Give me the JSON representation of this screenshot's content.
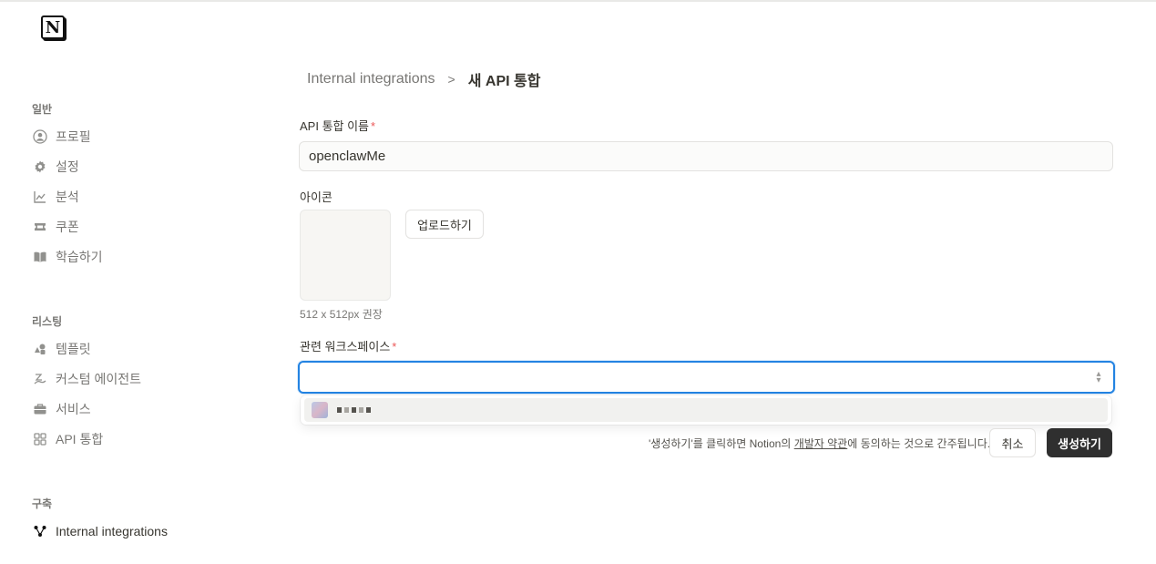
{
  "sidebar": {
    "sections": [
      {
        "label": "일반",
        "items": [
          {
            "label": "프로필",
            "icon": "profile-icon"
          },
          {
            "label": "설정",
            "icon": "gear-icon"
          },
          {
            "label": "분석",
            "icon": "chart-icon"
          },
          {
            "label": "쿠폰",
            "icon": "ticket-icon"
          },
          {
            "label": "학습하기",
            "icon": "book-icon"
          }
        ]
      },
      {
        "label": "리스팅",
        "items": [
          {
            "label": "템플릿",
            "icon": "shapes-icon"
          },
          {
            "label": "커스텀 에이전트",
            "icon": "agent-icon"
          },
          {
            "label": "서비스",
            "icon": "briefcase-icon"
          },
          {
            "label": "API 통합",
            "icon": "grid-icon"
          }
        ]
      },
      {
        "label": "구축",
        "items": [
          {
            "label": "Internal integrations",
            "icon": "nodes-icon"
          }
        ]
      }
    ]
  },
  "breadcrumb": {
    "parent": "Internal integrations",
    "separator": ">",
    "current": "새 API 통합"
  },
  "form": {
    "name_label": "API 통합 이름",
    "required_mark": "*",
    "name_value": "openclawMe",
    "icon_label": "아이콘",
    "upload_label": "업로드하기",
    "icon_hint": "512 x 512px 권장",
    "workspace_label": "관련 워크스페이스",
    "workspace_value": ""
  },
  "footer": {
    "note_prefix": "'생성하기'를 클릭하면 Notion의 ",
    "note_link": "개발자 약관",
    "note_suffix": "에 동의하는 것으로 간주됩니다.",
    "cancel_label": "취소",
    "create_label": "생성하기"
  },
  "colors": {
    "accent": "#2383e2",
    "required": "#eb5757",
    "primary_button": "#2f2f2f"
  }
}
